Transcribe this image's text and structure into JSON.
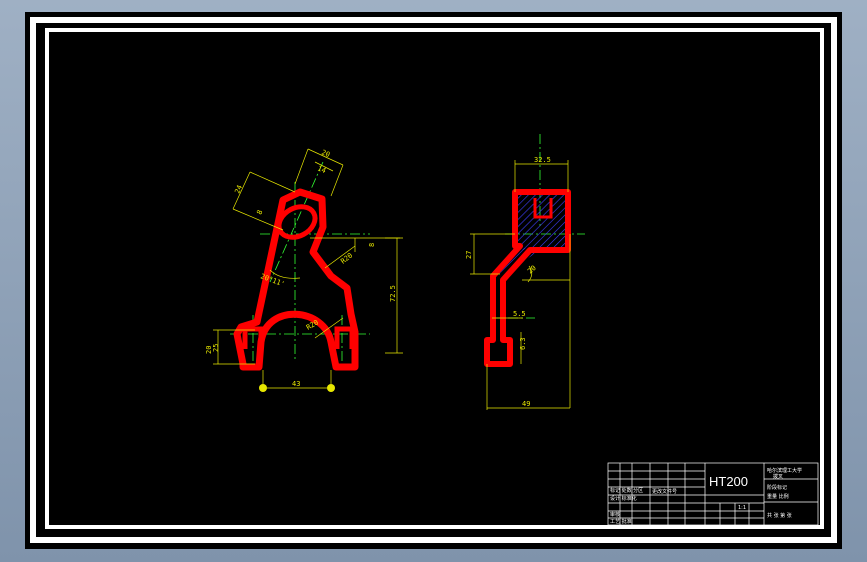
{
  "drawing": {
    "colors": {
      "background": "#000000",
      "frame": "#ffffff",
      "part_outline": "#ff0000",
      "centerline": "#33ff33",
      "dimension": "#e8e800",
      "hatch": "#4040ff"
    },
    "front_view": {
      "dims": {
        "d20_top": "20",
        "d14": "14",
        "d24": "24",
        "d8_left": "8",
        "d8_right": "8",
        "r20": "R20",
        "angle": "20°11'",
        "d725": "72.5",
        "r20_inner": "R20",
        "d20_left": "20",
        "d25_left": "25",
        "d43": "43"
      }
    },
    "side_view": {
      "dims": {
        "d325": "32.5",
        "d27": "27",
        "d55": "5.5",
        "d63": "6.3",
        "d49": "49",
        "d20_r": "20"
      }
    },
    "title_block": {
      "material": "HT200",
      "cells": {
        "r1": "标记 处数 分区",
        "r2": "更改文件号",
        "r3": "设计 标准化",
        "r4": "审核",
        "r5": "工艺 批准",
        "right_top": "哈尔滨理工大学",
        "right_top2": "拨叉",
        "right_mid": "阶段标记",
        "right_mid2": "重量 比例",
        "right_bot": "共 张 第 张",
        "scale_label": "1:1"
      }
    }
  }
}
